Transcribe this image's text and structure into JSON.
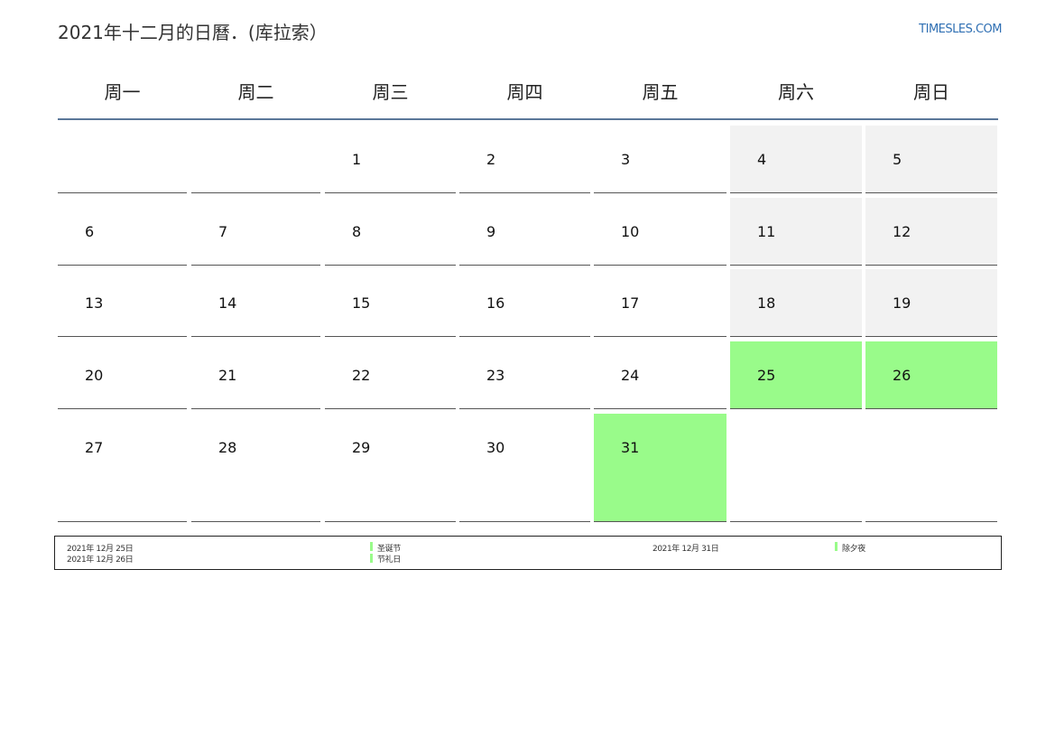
{
  "header": {
    "title": "2021年十二月的日曆．(库拉索）",
    "brand": "TIMESLES.COM"
  },
  "colors": {
    "holiday": "#99fb8a",
    "weekend": "#f2f2f2",
    "rule": "#5a7799",
    "brand": "#2f6fb3"
  },
  "weekdays": [
    "周一",
    "周二",
    "周三",
    "周四",
    "周五",
    "周六",
    "周日"
  ],
  "weeks": [
    [
      {
        "day": "",
        "type": "empty"
      },
      {
        "day": "",
        "type": "empty"
      },
      {
        "day": "1",
        "type": "normal"
      },
      {
        "day": "2",
        "type": "normal"
      },
      {
        "day": "3",
        "type": "normal"
      },
      {
        "day": "4",
        "type": "weekend"
      },
      {
        "day": "5",
        "type": "weekend"
      }
    ],
    [
      {
        "day": "6",
        "type": "normal"
      },
      {
        "day": "7",
        "type": "normal"
      },
      {
        "day": "8",
        "type": "normal"
      },
      {
        "day": "9",
        "type": "normal"
      },
      {
        "day": "10",
        "type": "normal"
      },
      {
        "day": "11",
        "type": "weekend"
      },
      {
        "day": "12",
        "type": "weekend"
      }
    ],
    [
      {
        "day": "13",
        "type": "normal"
      },
      {
        "day": "14",
        "type": "normal"
      },
      {
        "day": "15",
        "type": "normal"
      },
      {
        "day": "16",
        "type": "normal"
      },
      {
        "day": "17",
        "type": "normal"
      },
      {
        "day": "18",
        "type": "weekend"
      },
      {
        "day": "19",
        "type": "weekend"
      }
    ],
    [
      {
        "day": "20",
        "type": "normal"
      },
      {
        "day": "21",
        "type": "normal"
      },
      {
        "day": "22",
        "type": "normal"
      },
      {
        "day": "23",
        "type": "normal"
      },
      {
        "day": "24",
        "type": "normal"
      },
      {
        "day": "25",
        "type": "holiday"
      },
      {
        "day": "26",
        "type": "holiday"
      }
    ],
    [
      {
        "day": "27",
        "type": "normal"
      },
      {
        "day": "28",
        "type": "normal"
      },
      {
        "day": "29",
        "type": "normal"
      },
      {
        "day": "30",
        "type": "normal"
      },
      {
        "day": "31",
        "type": "holiday"
      },
      {
        "day": "",
        "type": "empty"
      },
      {
        "day": "",
        "type": "empty"
      }
    ]
  ],
  "legend": {
    "left": [
      {
        "date": "2021年 12月 25日",
        "name": "圣诞节"
      },
      {
        "date": "2021年 12月 26日",
        "name": "节礼日"
      }
    ],
    "right": [
      {
        "date": "2021年 12月 31日",
        "name": "除夕夜"
      }
    ]
  }
}
